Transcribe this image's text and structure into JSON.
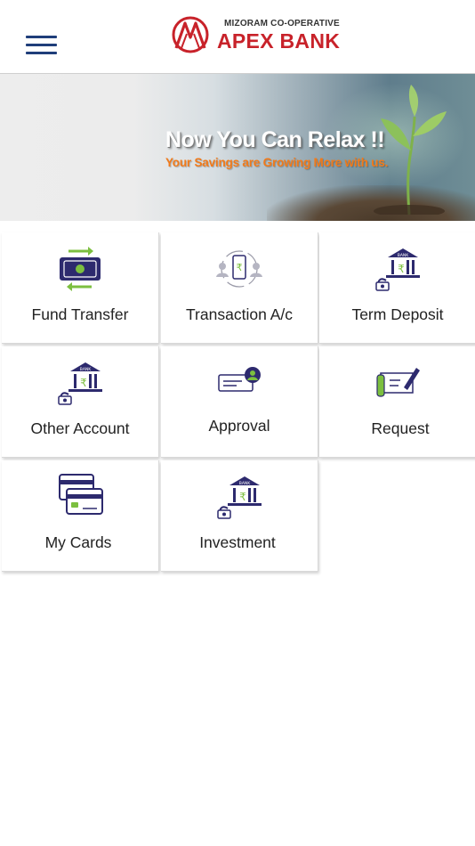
{
  "header": {
    "menu_icon": "hamburger-menu-icon",
    "logo_icon": "apex-bank-logo",
    "logo_top_text": "MIZORAM CO-OPERATIVE",
    "logo_main_text": "APEX BANK",
    "brand_color": "#c8222a"
  },
  "banner": {
    "title": "Now You Can Relax !!",
    "subtitle": "Your Savings are Growing More with us.",
    "subtitle_color": "#f17a1a"
  },
  "menu": {
    "items": [
      {
        "label": "Fund Transfer",
        "icon": "fund-transfer-icon"
      },
      {
        "label": "Transaction A/c",
        "icon": "transaction-account-icon"
      },
      {
        "label": "Term Deposit",
        "icon": "term-deposit-icon"
      },
      {
        "label": "Other Account",
        "icon": "other-account-icon"
      },
      {
        "label": "Approval",
        "icon": "approval-icon"
      },
      {
        "label": "Request",
        "icon": "request-icon"
      },
      {
        "label": "My Cards",
        "icon": "my-cards-icon"
      },
      {
        "label": "Investment",
        "icon": "investment-icon"
      }
    ]
  },
  "colors": {
    "icon_navy": "#2d2a6e",
    "icon_green": "#7cbf3f",
    "header_navy": "#1f3e7a"
  }
}
